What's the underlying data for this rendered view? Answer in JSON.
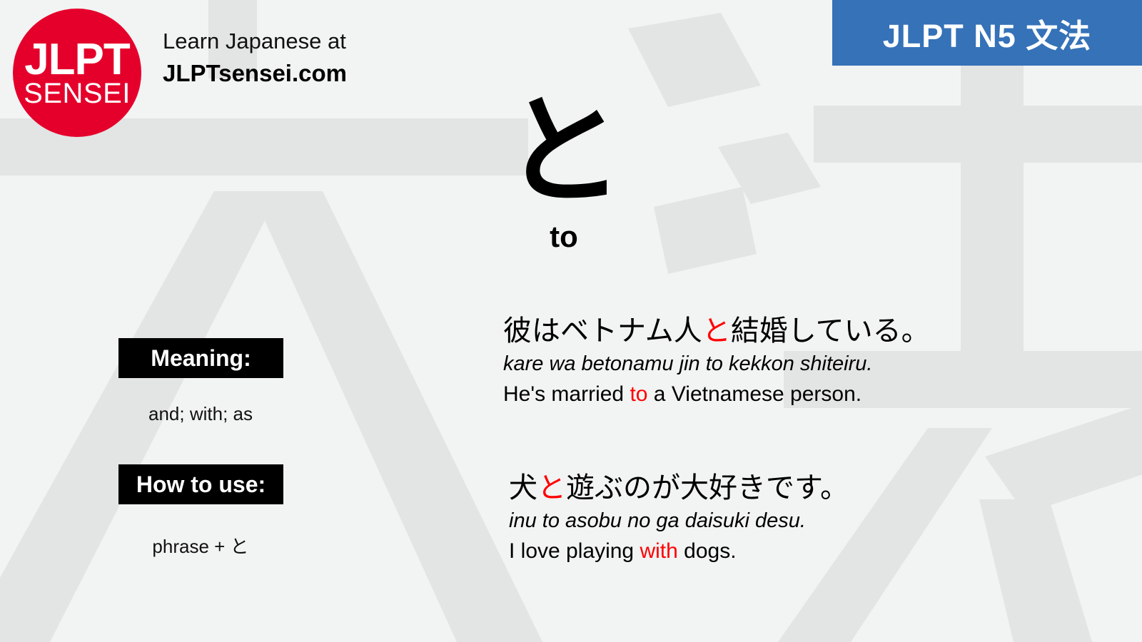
{
  "brand": {
    "logo_primary": "JLPT",
    "logo_secondary": "SENSEI",
    "logo_color": "#e4002b",
    "tagline": "Learn Japanese at",
    "site": "JLPTsensei.com"
  },
  "level_badge": {
    "label": "JLPT N5 文法",
    "background": "#3572b8",
    "text_color": "#ffffff"
  },
  "grammar_point": {
    "kana": "と",
    "romaji": "to"
  },
  "info": {
    "meaning_label": "Meaning:",
    "meaning_value": "and; with; as",
    "howto_label": "How to use:",
    "howto_value": "phrase + と"
  },
  "highlight_color": "#ff0000",
  "examples": [
    {
      "jp_before": "彼はベトナム人",
      "jp_highlight": "と",
      "jp_after": "結婚している。",
      "romaji": "kare wa betonamu jin to kekkon shiteiru.",
      "en_before": "He's married ",
      "en_highlight": "to",
      "en_after": " a Vietnamese person."
    },
    {
      "jp_before": "犬",
      "jp_highlight": "と",
      "jp_after": "遊ぶのが大好きです。",
      "romaji": "inu to asobu no ga daisuki desu.",
      "en_before": "I love playing ",
      "en_highlight": "with",
      "en_after": " dogs."
    }
  ],
  "background_watermark": {
    "characters": "文法",
    "color": "#e3e4e4"
  }
}
